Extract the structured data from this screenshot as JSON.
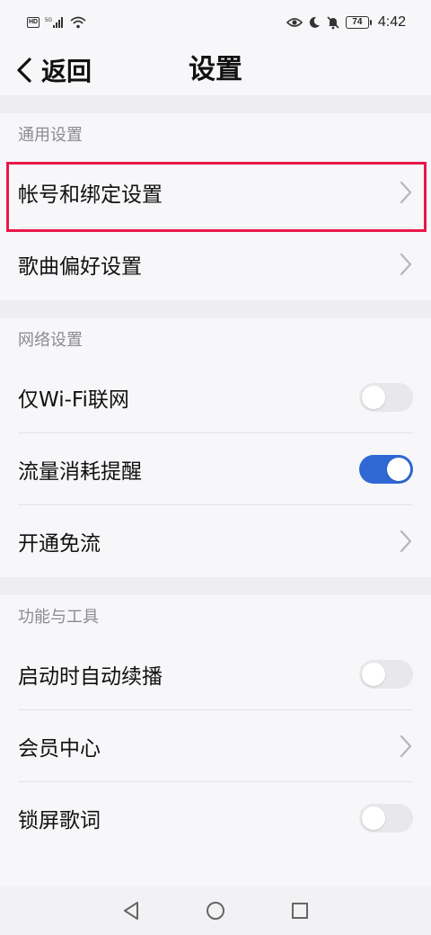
{
  "status_bar": {
    "network": "5G",
    "battery": "74",
    "time": "4:42"
  },
  "nav": {
    "back_label": "返回",
    "title": "设置"
  },
  "sections": [
    {
      "header": "通用设置",
      "rows": [
        {
          "label": "帐号和绑定设置",
          "type": "chevron"
        },
        {
          "label": "歌曲偏好设置",
          "type": "chevron"
        }
      ]
    },
    {
      "header": "网络设置",
      "rows": [
        {
          "label": "仅Wi-Fi联网",
          "type": "toggle",
          "on": false
        },
        {
          "label": "流量消耗提醒",
          "type": "toggle",
          "on": true
        },
        {
          "label": "开通免流",
          "type": "chevron"
        }
      ]
    },
    {
      "header": "功能与工具",
      "rows": [
        {
          "label": "启动时自动续播",
          "type": "toggle",
          "on": false
        },
        {
          "label": "会员中心",
          "type": "chevron"
        },
        {
          "label": "锁屏歌词",
          "type": "toggle",
          "on": false
        }
      ]
    }
  ],
  "colors": {
    "toggle_on": "#2f68d4",
    "toggle_off": "#e8e8eb",
    "highlight": "#e8174a"
  },
  "bottom_nav": [
    "back-triangle-icon",
    "home-circle-icon",
    "recents-square-icon"
  ]
}
